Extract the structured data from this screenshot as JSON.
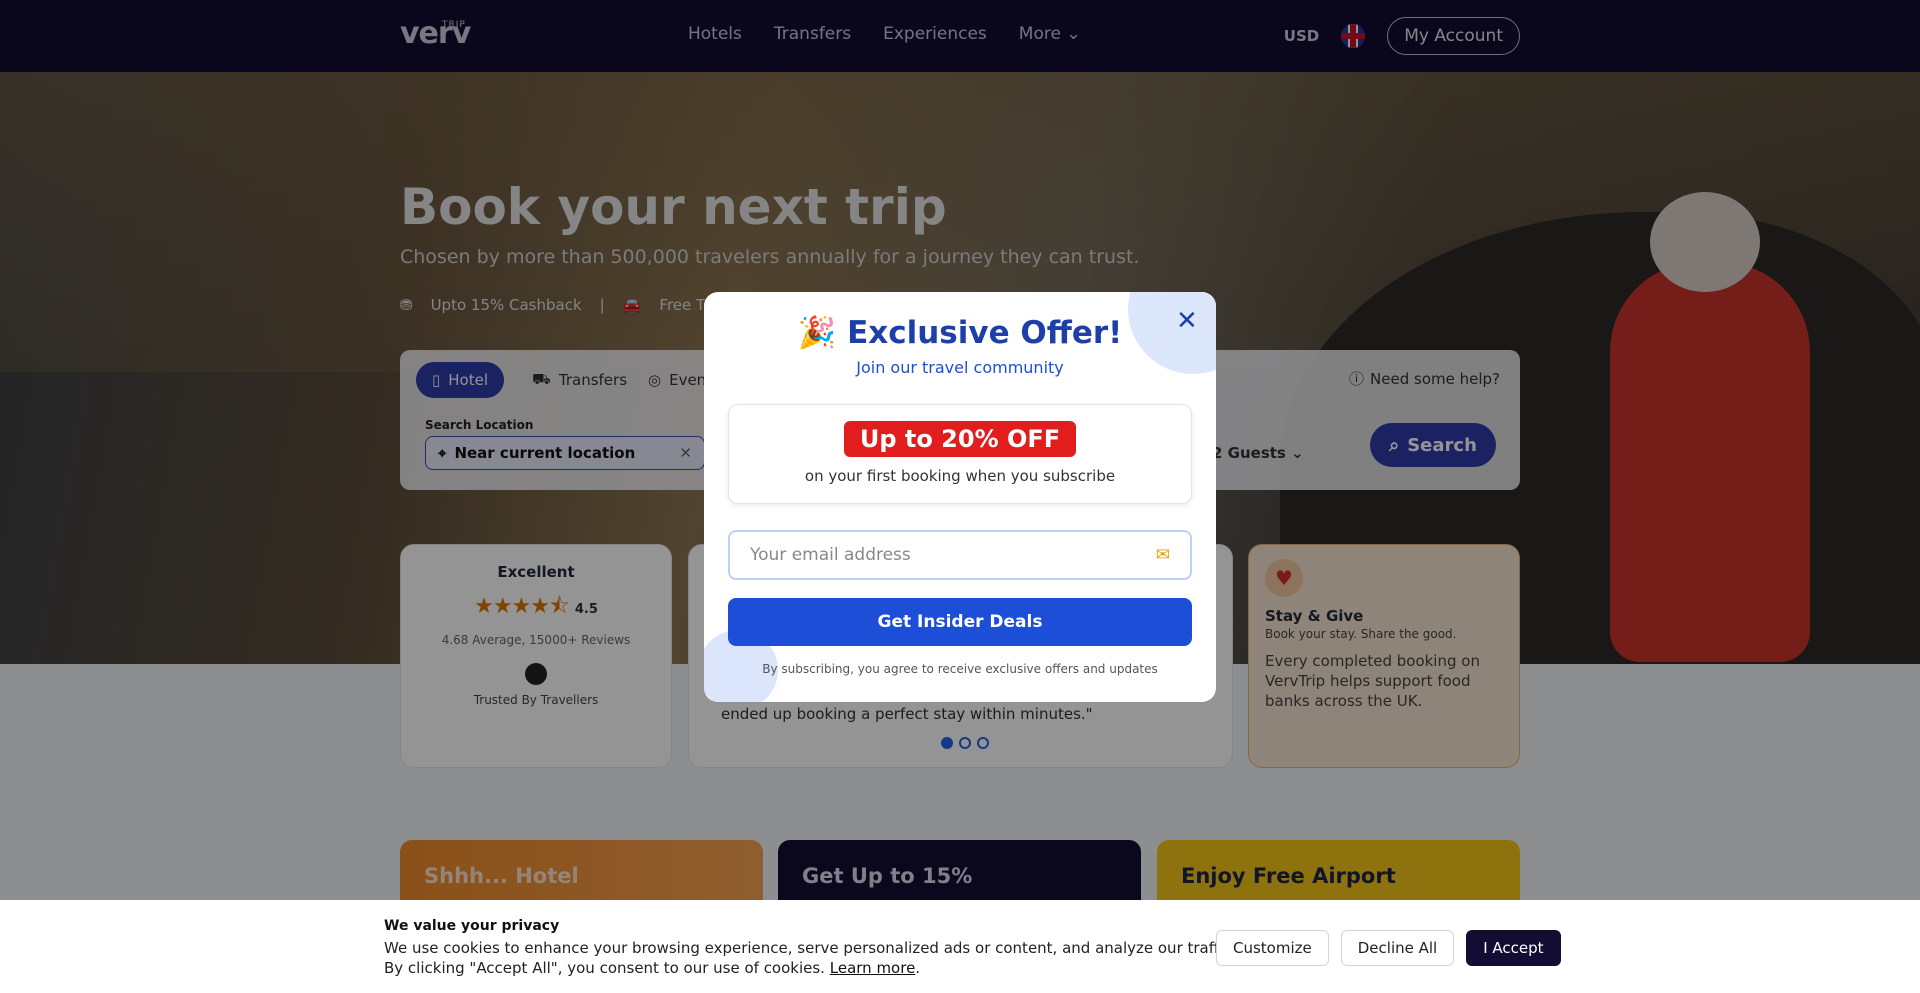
{
  "nav": {
    "logo_small": "TRIP",
    "logo": "verv",
    "links": [
      "Hotels",
      "Transfers",
      "Experiences",
      "More ⌄"
    ],
    "currency": "USD",
    "account": "My Account"
  },
  "hero": {
    "title": "Book your next trip",
    "subtitle": "Chosen by more than 500,000 travelers annually for a journey they can trust.",
    "feature1": "Upto 15% Cashback",
    "feature2": "Free Tran"
  },
  "search": {
    "tabs": [
      "Hotel",
      "Transfers",
      "Even"
    ],
    "help": "Need some help?",
    "location_label": "Search Location",
    "location_value": "Near current location",
    "guests": "2 Guests",
    "button": "Search"
  },
  "rating": {
    "title": "Excellent",
    "score": "4.5",
    "stars_value": 4.5,
    "average": "4.68 Average, 15000+ Reviews",
    "trusted": "Trusted By Travellers"
  },
  "review": {
    "quote": "ended up booking a perfect stay within minutes.\""
  },
  "give": {
    "title": "Stay & Give",
    "sub": "Book your stay. Share the good.",
    "body": "Every completed booking on VervTrip helps support food banks across the UK."
  },
  "promos": [
    "Shhh... Hotel",
    "Get Up to 15%",
    "Enjoy Free Airport"
  ],
  "modal": {
    "title": "Exclusive Offer!",
    "subtitle": "Join our travel community",
    "badge": "Up to 20% OFF",
    "badge_text": "on your first booking when you subscribe",
    "email_placeholder": "Your email address",
    "button": "Get Insider Deals",
    "note": "By subscribing, you agree to receive exclusive offers and updates"
  },
  "cookie": {
    "title": "We value your privacy",
    "line1": "We use cookies to enhance your browsing experience, serve personalized ads or content, and analyze our traffic.",
    "line2": "By clicking \"Accept All\", you consent to our use of cookies.",
    "learn": "Learn more",
    "customize": "Customize",
    "decline": "Decline All",
    "accept": "I Accept"
  },
  "colors": {
    "nav": "#120d33",
    "primary": "#2f3ba9",
    "modal_blue": "#1d4ed8",
    "badge_red": "#e11d1d"
  }
}
